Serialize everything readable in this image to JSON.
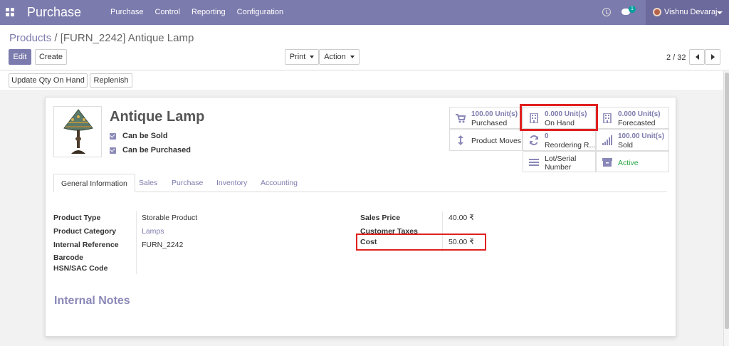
{
  "navbar": {
    "app_title": "Purchase",
    "menu": [
      "Purchase",
      "Control",
      "Reporting",
      "Configuration"
    ],
    "chat_count": "1",
    "user_name": "Vishnu Devaraj"
  },
  "breadcrumb": {
    "parent": "Products",
    "separator": "/",
    "current": "[FURN_2242] Antique Lamp"
  },
  "control_panel": {
    "edit_label": "Edit",
    "create_label": "Create",
    "print_label": "Print",
    "action_label": "Action",
    "pager": "2 / 32"
  },
  "header_buttons": {
    "update_qty": "Update Qty On Hand",
    "replenish": "Replenish"
  },
  "product": {
    "name": "Antique Lamp",
    "can_be_sold": "Can be Sold",
    "can_be_purchased": "Can be Purchased"
  },
  "smart_buttons": {
    "purchased_value": "100.00 Unit(s)",
    "purchased_label": "Purchased",
    "on_hand_value": "0.000 Unit(s)",
    "on_hand_label": "On Hand",
    "forecasted_value": "0.000 Unit(s)",
    "forecasted_label": "Forecasted",
    "moves_label": "Product Moves",
    "reordering_value": "0",
    "reordering_label": "Reordering R...",
    "sold_value": "100.00 Unit(s)",
    "sold_label": "Sold",
    "lot_label_1": "Lot/Serial",
    "lot_label_2": "Number",
    "active_label": "Active"
  },
  "tabs": [
    "General Information",
    "Sales",
    "Purchase",
    "Inventory",
    "Accounting"
  ],
  "general": {
    "product_type_label": "Product Type",
    "product_type": "Storable Product",
    "category_label": "Product Category",
    "category": "Lamps",
    "internal_ref_label": "Internal Reference",
    "internal_ref": "FURN_2242",
    "barcode_label": "Barcode",
    "hsn_label": "HSN/SAC Code",
    "sales_price_label": "Sales Price",
    "sales_price": "40.00 ₹",
    "customer_taxes_label": "Customer Taxes",
    "cost_label": "Cost",
    "cost": "50.00 ₹"
  },
  "notes": {
    "title": "Internal Notes"
  },
  "colors": {
    "brand": "#7c7bad",
    "highlight": "#e02020",
    "active_green": "#28a745"
  }
}
